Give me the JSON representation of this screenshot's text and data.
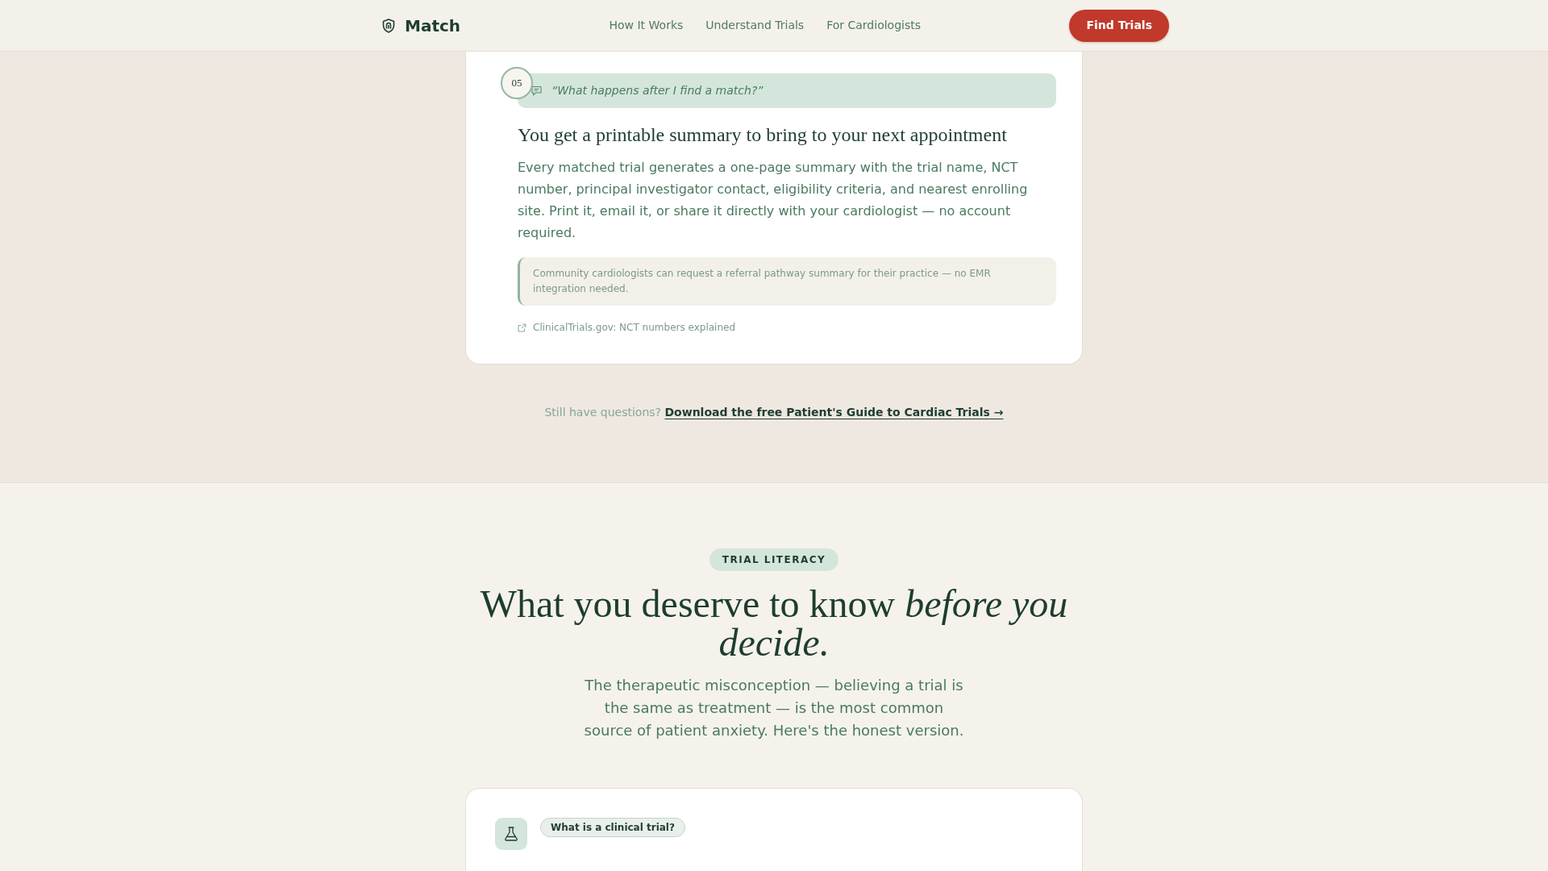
{
  "navbar": {
    "brand": "Match",
    "links": [
      "How It Works",
      "Understand Trials",
      "For Cardiologists"
    ],
    "cta": "Find Trials"
  },
  "faq_item": {
    "number": "05",
    "question": "“What happens after I find a match?”",
    "answer_title": "You get a printable summary to bring to your next appointment",
    "answer": "Every matched trial generates a one-page summary with the trial name, NCT number, principal investigator contact, eligibility criteria, and nearest enrolling site. Print it, email it, or share it directly with your cardiologist — no account required.",
    "note": "Community cardiologists can request a referral pathway summary for their practice — no EMR integration needed.",
    "source_link": "ClinicalTrials.gov: NCT numbers explained"
  },
  "questions_prompt": {
    "text": "Still have questions?",
    "link": "Download the free Patient's Guide to Cardiac Trials →"
  },
  "trial_literacy": {
    "badge": "TRIAL LITERACY",
    "heading": "What you deserve to know *before you decide.*",
    "intro": "The therapeutic misconception — believing a trial is the same as treatment — is the most common source of patient anxiety. Here's the honest version.",
    "cards": [
      {
        "question": "What is a clinical trial?"
      }
    ]
  }
}
